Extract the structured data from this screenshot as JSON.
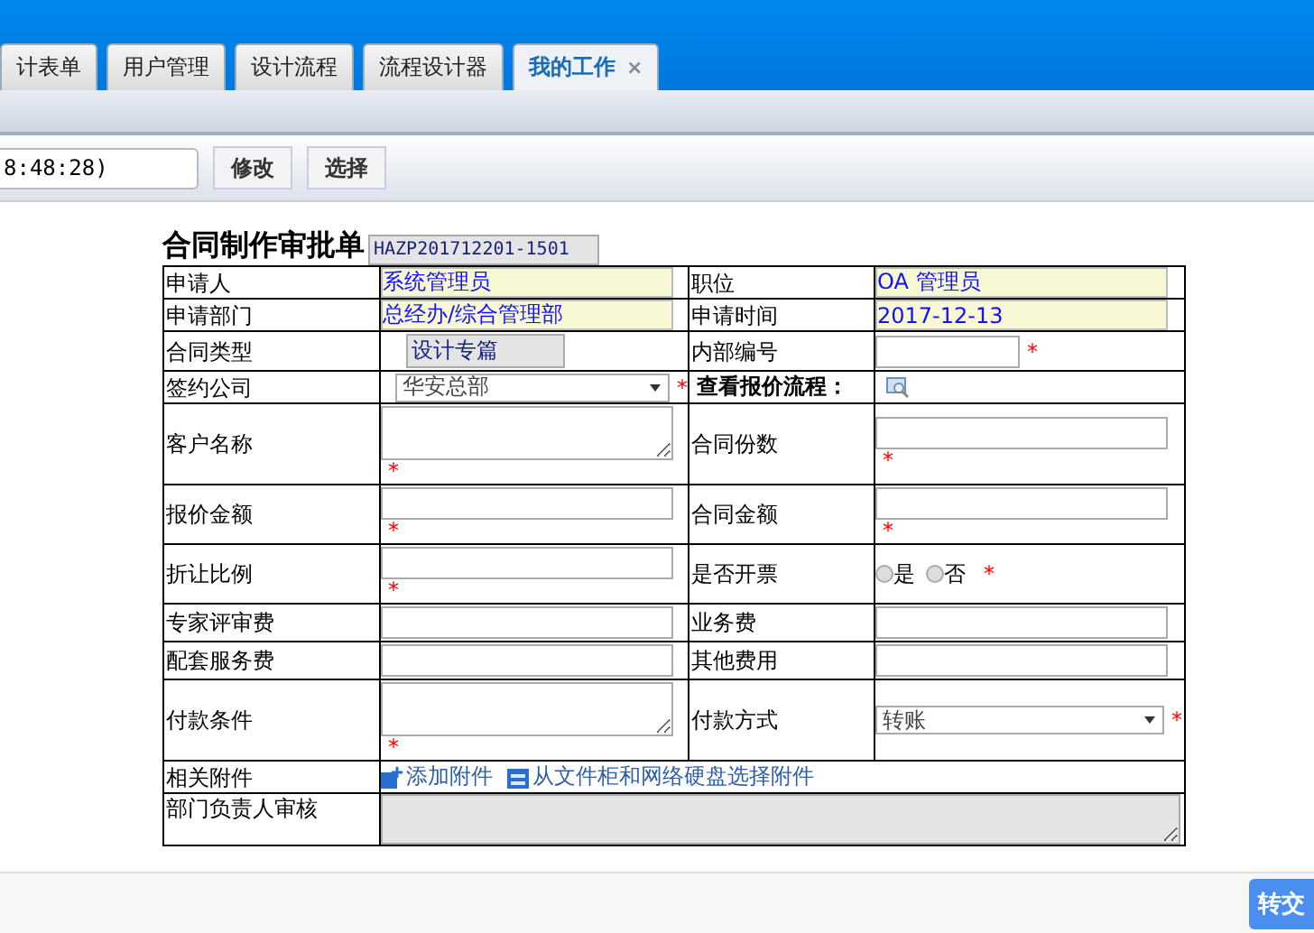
{
  "tabs": [
    {
      "label": "计表单",
      "selected": false
    },
    {
      "label": "用户管理",
      "selected": false
    },
    {
      "label": "设计流程",
      "selected": false
    },
    {
      "label": "流程设计器",
      "selected": false
    },
    {
      "label": "我的工作",
      "selected": true,
      "close": "×"
    }
  ],
  "toolbar": {
    "field_value": "8:48:28)",
    "buttons": [
      "修改",
      "选择"
    ]
  },
  "form": {
    "title": "合同制作审批单",
    "serial": "HAZP201712201-1501",
    "rows": [
      {
        "cells": [
          {
            "kind": "label",
            "text": "申请人"
          },
          {
            "kind": "readonly",
            "value": "系统管理员"
          },
          {
            "kind": "label",
            "text": "职位"
          },
          {
            "kind": "readonly",
            "value": "OA 管理员"
          }
        ]
      },
      {
        "cells": [
          {
            "kind": "label",
            "text": "申请部门"
          },
          {
            "kind": "readonly",
            "value": "总经办/综合管理部"
          },
          {
            "kind": "label",
            "text": "申请时间"
          },
          {
            "kind": "readonly",
            "value": "2017-12-13"
          }
        ]
      },
      {
        "cells": [
          {
            "kind": "label",
            "text": "合同类型"
          },
          {
            "kind": "gray",
            "value": "设计专篇"
          },
          {
            "kind": "label",
            "text": "内部编号"
          },
          {
            "kind": "short-input",
            "mark": "*"
          }
        ]
      },
      {
        "cells": [
          {
            "kind": "label",
            "text": "签约公司"
          },
          {
            "kind": "select",
            "value": "华安总部",
            "mark": "*"
          },
          {
            "kind": "link",
            "text": "查看报价流程："
          },
          {
            "kind": "lookup"
          }
        ]
      },
      {
        "cells": [
          {
            "kind": "label",
            "text": "客户名称"
          },
          {
            "kind": "textarea",
            "mark": "*"
          },
          {
            "kind": "label",
            "text": "合同份数"
          },
          {
            "kind": "input",
            "mark": "*"
          }
        ]
      },
      {
        "cells": [
          {
            "kind": "label",
            "text": "报价金额"
          },
          {
            "kind": "input",
            "mark": "*"
          },
          {
            "kind": "label",
            "text": "合同金额"
          },
          {
            "kind": "input",
            "mark": "*"
          }
        ]
      },
      {
        "cells": [
          {
            "kind": "label",
            "text": "折让比例"
          },
          {
            "kind": "input",
            "mark": "*"
          },
          {
            "kind": "label",
            "text": "是否开票"
          },
          {
            "kind": "radio",
            "options": [
              {
                "label": "是",
                "selected": false
              },
              {
                "label": "否",
                "selected": false
              }
            ],
            "mark": "*"
          }
        ]
      },
      {
        "cells": [
          {
            "kind": "label",
            "text": "专家评审费"
          },
          {
            "kind": "input"
          },
          {
            "kind": "label",
            "text": "业务费"
          },
          {
            "kind": "input"
          }
        ]
      },
      {
        "cells": [
          {
            "kind": "label",
            "text": "配套服务费"
          },
          {
            "kind": "input"
          },
          {
            "kind": "label",
            "text": "其他费用"
          },
          {
            "kind": "input"
          }
        ]
      },
      {
        "cells": [
          {
            "kind": "label",
            "text": "付款条件"
          },
          {
            "kind": "textarea",
            "mark": "*"
          },
          {
            "kind": "label",
            "text": "付款方式"
          },
          {
            "kind": "select",
            "value": "转账",
            "mark": "*"
          }
        ]
      },
      {
        "cells": [
          {
            "kind": "label",
            "text": "相关附件"
          },
          {
            "kind": "attachments",
            "links": [
              "添加附件",
              "从文件柜和网络硬盘选择附件"
            ],
            "colspan": 3
          }
        ]
      },
      {
        "cells": [
          {
            "kind": "label",
            "text": "部门负责人审核"
          },
          {
            "kind": "review",
            "colspan": 3
          }
        ]
      }
    ]
  },
  "footer": {
    "button": "转交"
  }
}
